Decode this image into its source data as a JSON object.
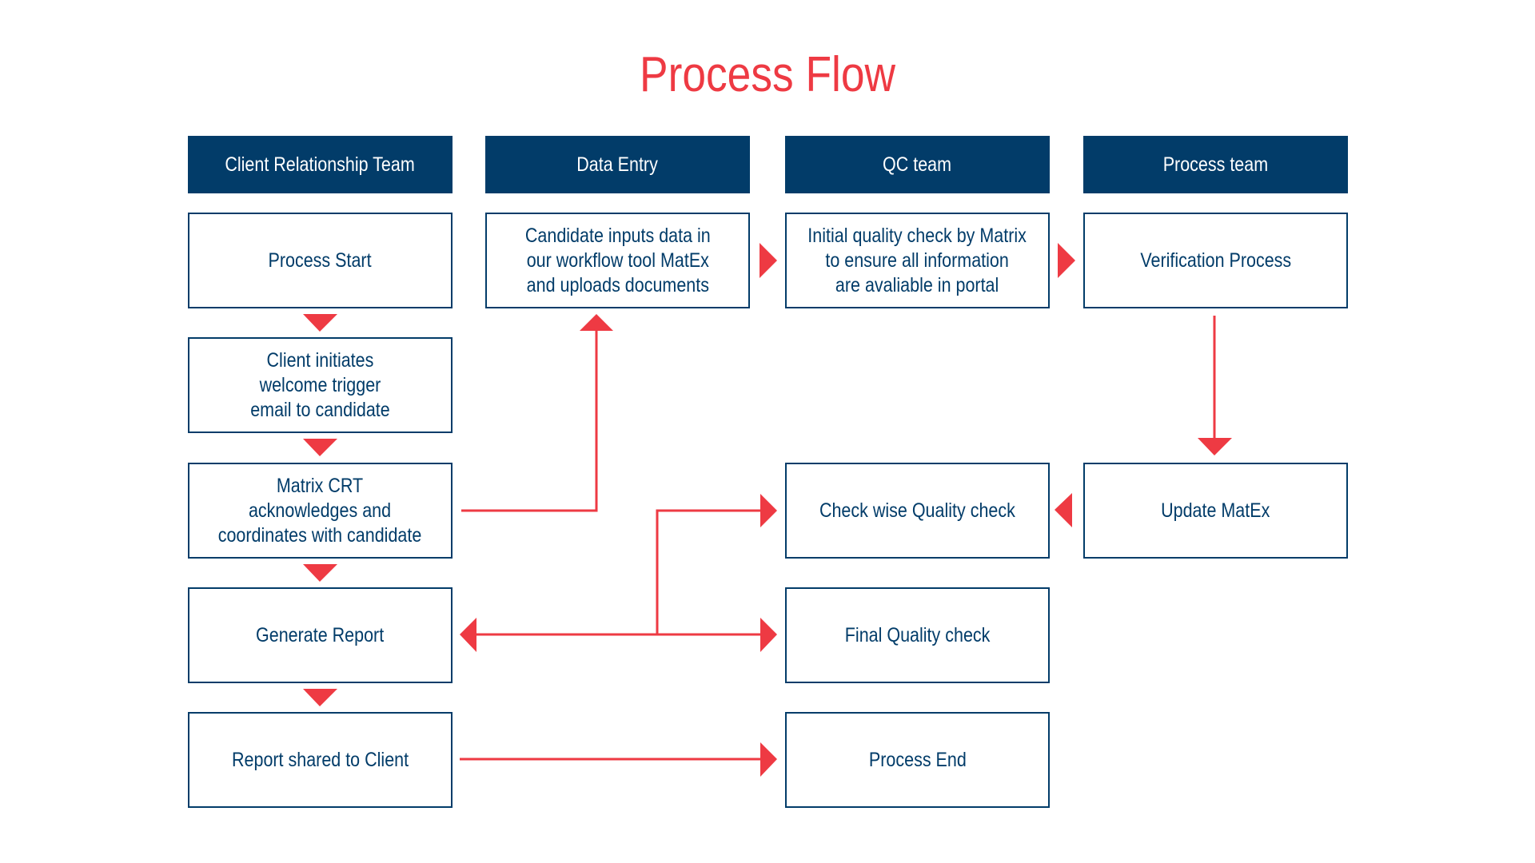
{
  "title": "Process Flow",
  "colors": {
    "accent": "#EE3A43",
    "navy": "#023C69",
    "background": "#FFFFFF"
  },
  "lanes": [
    {
      "label": "Client Relationship Team"
    },
    {
      "label": "Data Entry"
    },
    {
      "label": "QC team"
    },
    {
      "label": "Process team"
    }
  ],
  "steps": {
    "process_start": {
      "lines": [
        "Process Start"
      ]
    },
    "client_initiates": {
      "lines": [
        "Client initiates",
        "welcome trigger",
        "email to candidate"
      ]
    },
    "matrix_crt": {
      "lines": [
        "Matrix CRT",
        "acknowledges and",
        "coordinates with candidate"
      ]
    },
    "generate_report": {
      "lines": [
        "Generate Report"
      ]
    },
    "report_shared": {
      "lines": [
        "Report shared to Client"
      ]
    },
    "candidate_inputs": {
      "lines": [
        "Candidate inputs data in",
        "our workflow tool MatEx",
        "and uploads documents"
      ]
    },
    "initial_qc": {
      "lines": [
        "Initial quality check by Matrix",
        "to ensure all information",
        "are avaliable in portal"
      ]
    },
    "check_wise_qc": {
      "lines": [
        "Check wise Quality check"
      ]
    },
    "final_qc": {
      "lines": [
        "Final Quality check"
      ]
    },
    "process_end": {
      "lines": [
        "Process End"
      ]
    },
    "verification": {
      "lines": [
        "Verification Process"
      ]
    },
    "update_matex": {
      "lines": [
        "Update MatEx"
      ]
    }
  },
  "connections": [
    {
      "from": "process_start",
      "to": "client_initiates"
    },
    {
      "from": "client_initiates",
      "to": "matrix_crt"
    },
    {
      "from": "matrix_crt",
      "to": "generate_report"
    },
    {
      "from": "generate_report",
      "to": "report_shared"
    },
    {
      "from": "matrix_crt",
      "to": "candidate_inputs"
    },
    {
      "from": "candidate_inputs",
      "to": "initial_qc"
    },
    {
      "from": "initial_qc",
      "to": "verification"
    },
    {
      "from": "verification",
      "to": "update_matex"
    },
    {
      "from": "update_matex",
      "to": "check_wise_qc"
    },
    {
      "from": "check_wise_qc",
      "to": "final_qc"
    },
    {
      "from": "final_qc",
      "to": "generate_report"
    },
    {
      "from": "report_shared",
      "to": "process_end"
    }
  ]
}
